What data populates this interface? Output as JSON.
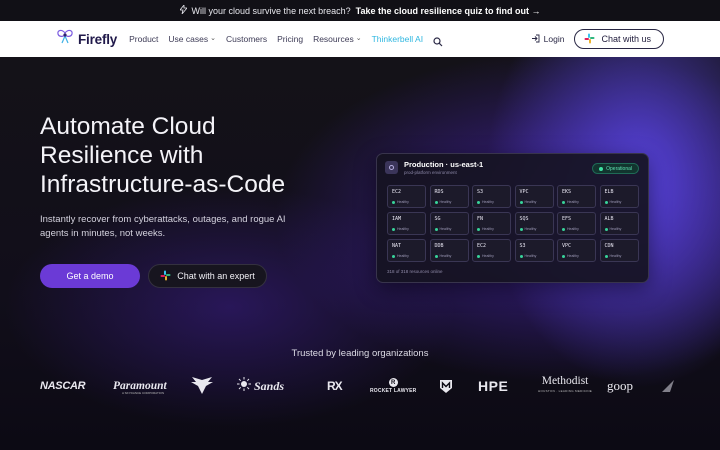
{
  "announcement": {
    "icon": "lightning-bolt-icon",
    "text": "Will your cloud survive the next breach?",
    "link": "Take the cloud resilience quiz to find out →"
  },
  "nav": {
    "logo": "Firefly",
    "links": [
      "Product",
      "Use cases",
      "Customers",
      "Pricing",
      "Resources",
      "Thinkerbell AI"
    ],
    "login": "Login",
    "chat": "Chat with us"
  },
  "hero": {
    "title": "Automate Cloud Resilience with Infrastructure-as-Code",
    "subtitle": "Instantly recover from cyberattacks, outages, and rogue AI agents in minutes, not weeks.",
    "primary_cta": "Get a demo",
    "secondary_cta": "Chat with an expert"
  },
  "dashboard": {
    "title": "Production · us-east-1",
    "subtitle": "prod-platform environment",
    "status": "Operational",
    "cell_status": "Healthy",
    "services": [
      "EC2",
      "RDS",
      "S3",
      "VPC",
      "EKS",
      "ELB",
      "IAM",
      "SG",
      "FN",
      "SQS",
      "EFS",
      "ALB",
      "NAT",
      "DDB",
      "EC2",
      "S3",
      "VPC",
      "CDN"
    ],
    "footer": "318 of 318 resources online"
  },
  "trusted": {
    "heading": "Trusted by leading organizations",
    "logos": {
      "nascar": "NASCAR",
      "paramount": "Paramount",
      "paramount_sub": "A SKYDANCE CORPORATION",
      "sands": "Sands",
      "rx": "RX",
      "rocket_initial": "R",
      "rocket": "ROCKET LAWYER",
      "hpe": "HPE",
      "methodist": "Methodist",
      "methodist_sub": "HOUSTON · LEADING MEDICINE",
      "goop": "goop"
    }
  },
  "colors": {
    "primary": "#6b3ad6",
    "accent": "#2fb7e0",
    "healthy": "#38d39a",
    "nav_bg": "#ffffff",
    "page_bg": "#0c0a14"
  }
}
